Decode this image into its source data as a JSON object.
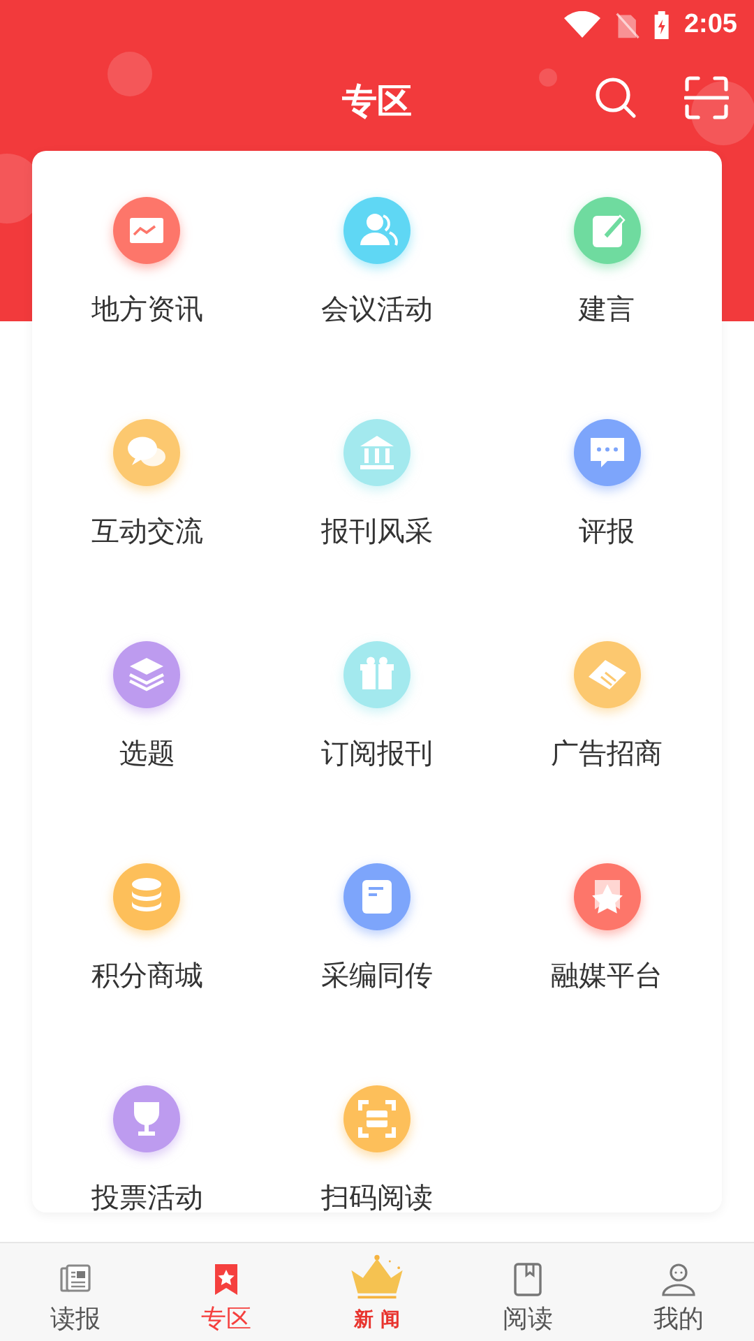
{
  "status_bar": {
    "time": "2:05"
  },
  "header": {
    "title": "专区"
  },
  "items": [
    {
      "label": "地方资讯",
      "kind": "chart",
      "color": "#fd766a"
    },
    {
      "label": "会议活动",
      "kind": "people",
      "color": "#5fd7f4"
    },
    {
      "label": "建言",
      "kind": "note",
      "color": "#6fdb9f"
    },
    {
      "label": "互动交流",
      "kind": "chat",
      "color": "#fcc86f"
    },
    {
      "label": "报刊风采",
      "kind": "bank",
      "color": "#a3e9ee"
    },
    {
      "label": "评报",
      "kind": "message",
      "color": "#7da5fb"
    },
    {
      "label": "选题",
      "kind": "layers",
      "color": "#bd9bef"
    },
    {
      "label": "订阅报刊",
      "kind": "gift",
      "color": "#a3e9ee"
    },
    {
      "label": "广告招商",
      "kind": "handshake",
      "color": "#fcc86f"
    },
    {
      "label": "积分商城",
      "kind": "coins",
      "color": "#fdbf5a"
    },
    {
      "label": "采编同传",
      "kind": "doc",
      "color": "#7da5fb"
    },
    {
      "label": "融媒平台",
      "kind": "star",
      "color": "#fd766a"
    },
    {
      "label": "投票活动",
      "kind": "trophy",
      "color": "#bd9bef"
    },
    {
      "label": "扫码阅读",
      "kind": "scan",
      "color": "#fdbf5a"
    }
  ],
  "nav": [
    {
      "label": "读报",
      "kind": "paper",
      "selected": false
    },
    {
      "label": "专区",
      "kind": "bookmark",
      "selected": true
    },
    {
      "label": "新 闻",
      "kind": "crown",
      "selected": false
    },
    {
      "label": "阅读",
      "kind": "book",
      "selected": false
    },
    {
      "label": "我的",
      "kind": "user",
      "selected": false
    }
  ]
}
